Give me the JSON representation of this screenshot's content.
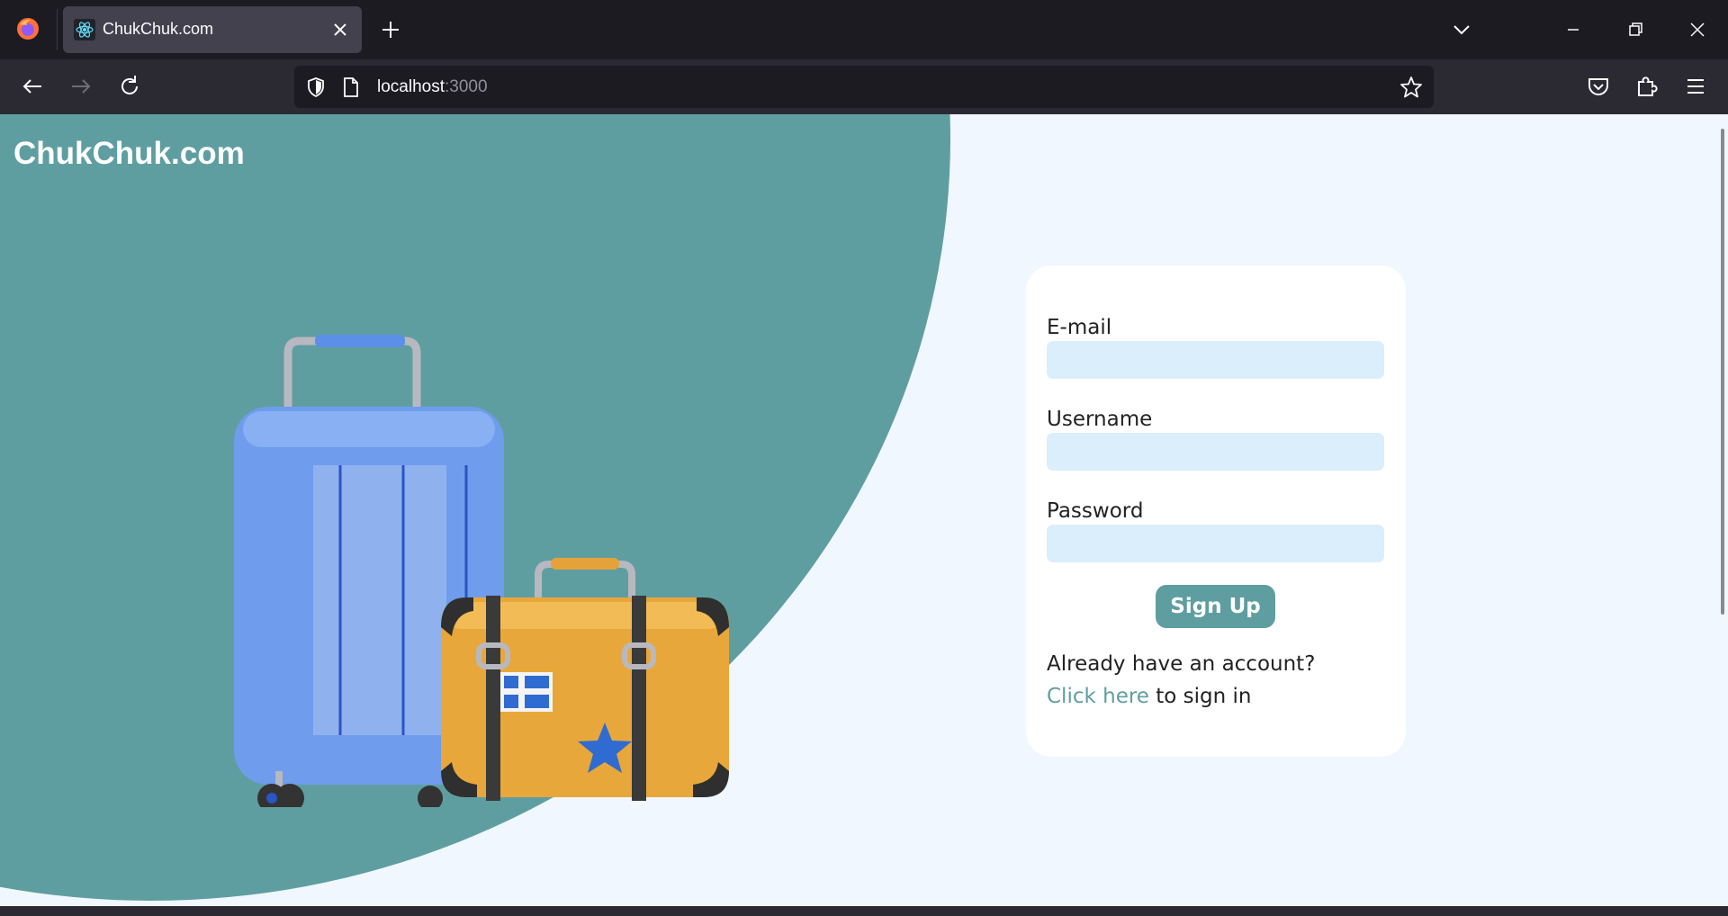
{
  "browser": {
    "tab_title": "ChukChuk.com",
    "url_host": "localhost",
    "url_port": ":3000"
  },
  "page": {
    "brand": "ChukChuk.com",
    "colors": {
      "teal": "#5f9ea0",
      "background": "#f0f7fe",
      "input_bg": "#dbeefc"
    }
  },
  "form": {
    "email_label": "E-mail",
    "email_value": "",
    "username_label": "Username",
    "username_value": "",
    "password_label": "Password",
    "password_value": "",
    "submit_label": "Sign Up",
    "already_text": "Already have an account?",
    "signin_link_text": "Click here",
    "signin_suffix": " to sign in"
  }
}
